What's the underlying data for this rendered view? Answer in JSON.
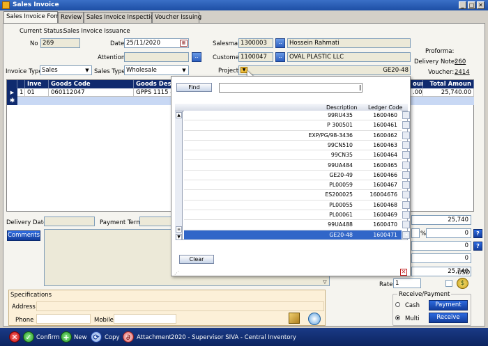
{
  "window": {
    "title": "Sales Invoice"
  },
  "tabs": [
    "Sales Invoice Form",
    "Review",
    "Sales Invoice Inspection",
    "Voucher Issuing"
  ],
  "header": {
    "current_status_label": "Current Status:",
    "current_status": "Sales Invoice Issuance",
    "no_label": "No",
    "no_value": "269",
    "date_label": "Date",
    "date_value": "25/11/2020",
    "attention_label": "Attention",
    "attention_value": "",
    "invoice_type_label": "Invoice Type",
    "invoice_type_value": "Sales",
    "sales_type_label": "Sales Type",
    "sales_type_value": "Wholesale",
    "salesman_label": "Salesman",
    "salesman_code": "1300003",
    "salesman_name": "Hossein Rahmati",
    "customer_label": "Customer",
    "customer_code": "1100047",
    "customer_name": "OVAL PLASTIC LLC",
    "project_label": "Project",
    "project_value": "GE20-48",
    "proforma_label": "Proforma:",
    "delivery_note_label": "Delivery Note:",
    "delivery_note_value": "260",
    "voucher_label": "Voucher:",
    "voucher_value": "2414"
  },
  "grid": {
    "headers": [
      "Inve",
      "Goods Code",
      "Goods Descr",
      "ount",
      "Total Amoun"
    ],
    "rows": [
      {
        "num": "1",
        "inv": "01",
        "code": "060112047",
        "desc": "GPPS 1115 -",
        "disc": ".00",
        "total": "25,740.00"
      }
    ]
  },
  "lower": {
    "delivery_date_label": "Delivery Date",
    "payment_term_label": "Payment Term",
    "comments_label": "Comments",
    "sum1": "25,740",
    "pct_suffix": "%",
    "pct_value": "0",
    "val2": "0",
    "val3": "0",
    "total": "25,740",
    "currency": "USD",
    "rate_label": "Rate",
    "rate_value": "1",
    "specifications_label": "Specifications",
    "address_label": "Address",
    "phone_label": "Phone",
    "mobile_label": "Mobile",
    "receive_payment_label": "Receive/Payment",
    "cash_label": "Cash",
    "payment_button": "Payment",
    "multi_label": "Multi",
    "receive_button": "Receive"
  },
  "popup": {
    "find_button": "Find",
    "col_description": "Description",
    "col_ledger_code": "Ledger Code",
    "rows": [
      {
        "description": "99RU435",
        "code": "1600460"
      },
      {
        "description": "P 300501",
        "code": "1600461"
      },
      {
        "description": "EXP/PG/98-3436",
        "code": "1600462"
      },
      {
        "description": "99CN510",
        "code": "1600463"
      },
      {
        "description": "99CN35",
        "code": "1600464"
      },
      {
        "description": "99UA484",
        "code": "1600465"
      },
      {
        "description": "GE20-49",
        "code": "1600466"
      },
      {
        "description": "PL00059",
        "code": "1600467"
      },
      {
        "description": "ES200025",
        "code": "16004676"
      },
      {
        "description": "PL00055",
        "code": "1600468"
      },
      {
        "description": "PL00061",
        "code": "1600469"
      },
      {
        "description": "99UA488",
        "code": "1600470"
      },
      {
        "description": "GE20-48",
        "code": "1600471"
      }
    ],
    "clear_button": "Clear"
  },
  "statusbar": {
    "confirm": "Confirm",
    "new": "New",
    "copy": "Copy",
    "attachment": "Attachment",
    "info": "2020 - Supervisor SIVA - Central Inventory"
  },
  "colors": {
    "accent": "#133d9c",
    "selection": "#3166c8",
    "confirm": "#2e9e2e",
    "attachment": "#d02020"
  }
}
